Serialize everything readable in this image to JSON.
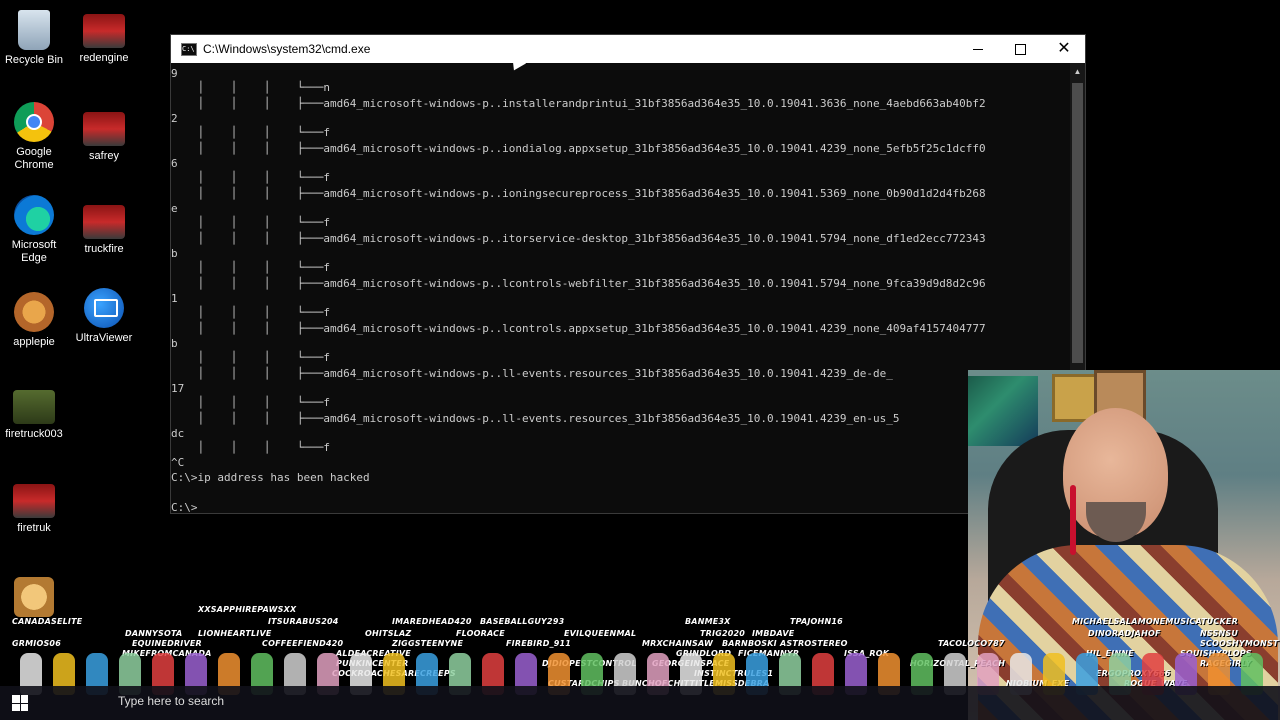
{
  "desktop": {
    "icons": [
      {
        "label": "Recycle Bin"
      },
      {
        "label": "redengine"
      },
      {
        "label": "Google Chrome"
      },
      {
        "label": "safrey"
      },
      {
        "label": "Microsoft Edge"
      },
      {
        "label": "truckfire"
      },
      {
        "label": "applepie"
      },
      {
        "label": "UltraViewer"
      },
      {
        "label": "firetruck003"
      },
      {
        "label": "firetruk"
      }
    ]
  },
  "cmd": {
    "title": "C:\\Windows\\system32\\cmd.exe",
    "lines": [
      "9",
      "    │    │    │    └───n",
      "    │    │    │    ├───amd64_microsoft-windows-p..installerandprintui_31bf3856ad364e35_10.0.19041.3636_none_4aebd663ab40bf2",
      "2",
      "    │    │    │    └───f",
      "    │    │    │    ├───amd64_microsoft-windows-p..iondialog.appxsetup_31bf3856ad364e35_10.0.19041.4239_none_5efb5f25c1dcff0",
      "6",
      "    │    │    │    └───f",
      "    │    │    │    ├───amd64_microsoft-windows-p..ioningsecureprocess_31bf3856ad364e35_10.0.19041.5369_none_0b90d1d2d4fb268",
      "e",
      "    │    │    │    └───f",
      "    │    │    │    ├───amd64_microsoft-windows-p..itorservice-desktop_31bf3856ad364e35_10.0.19041.5794_none_df1ed2ecc772343",
      "b",
      "    │    │    │    └───f",
      "    │    │    │    ├───amd64_microsoft-windows-p..lcontrols-webfilter_31bf3856ad364e35_10.0.19041.5794_none_9fca39d9d8d2c96",
      "1",
      "    │    │    │    └───f",
      "    │    │    │    ├───amd64_microsoft-windows-p..lcontrols.appxsetup_31bf3856ad364e35_10.0.19041.4239_none_409af4157404777",
      "b",
      "    │    │    │    └───f",
      "    │    │    │    ├───amd64_microsoft-windows-p..ll-events.resources_31bf3856ad364e35_10.0.19041.4239_de-de_",
      "17",
      "    │    │    │    └───f",
      "    │    │    │    ├───amd64_microsoft-windows-p..ll-events.resources_31bf3856ad364e35_10.0.19041.4239_en-us_5",
      "dc",
      "    │    │    │    └───f",
      "^C",
      "C:\\>ip address has been hacked",
      "",
      "C:\\>_"
    ]
  },
  "chat": {
    "names": [
      "XXSAPPHIREPAWSXX",
      "CANADASELITE",
      "DANNYSOTA",
      "LIONHEARTLIVE",
      "ITSURABUS204",
      "IMAREDHEAD420",
      "BASEBALLGUY293",
      "BANME3X",
      "TPAJOHN16",
      "MICHAELSALAMONEMUSICATUCKER",
      "GRMIOS06",
      "EQUINEDRIVER",
      "MIKEFROMCANADA",
      "COFFEEFIEND420",
      "OHITSLAZ",
      "ZIGGSTEENYNE",
      "FLOORACE",
      "EVILQUEENMAL",
      "TRIG2020",
      "IMBDAVE",
      "DINORADJAHOF",
      "NSSNSU",
      "SCOOSHYMONST",
      "ALDEACREATIVE",
      "PUNKINCENTER",
      "COCKROACHESARECREEPS",
      "FIREBIRD_911",
      "DJDIOPESTCONTROL",
      "MRXCHAINSAW",
      "BARNBOSKI",
      "ASTROSTEREO",
      "GRINDLORD",
      "FICEMANNYR",
      "GEORGEINSPACE",
      "INSTINCTRULES1",
      "CUSTARDCHIPS",
      "BUNCHOFCHITTITLEMISSDEBRA",
      "ISSA_ROK",
      "TACOLOCO787",
      "HORIZONTAL_PEACH",
      "HIL_EINNE",
      "SQUISHYPLOPS",
      "RAGEGIRLY",
      "NIOBIUM_EXE",
      "ERGOPROXY666",
      "ROGUE_WAVE"
    ]
  },
  "taskbar": {
    "search_text": "Type here to search"
  }
}
